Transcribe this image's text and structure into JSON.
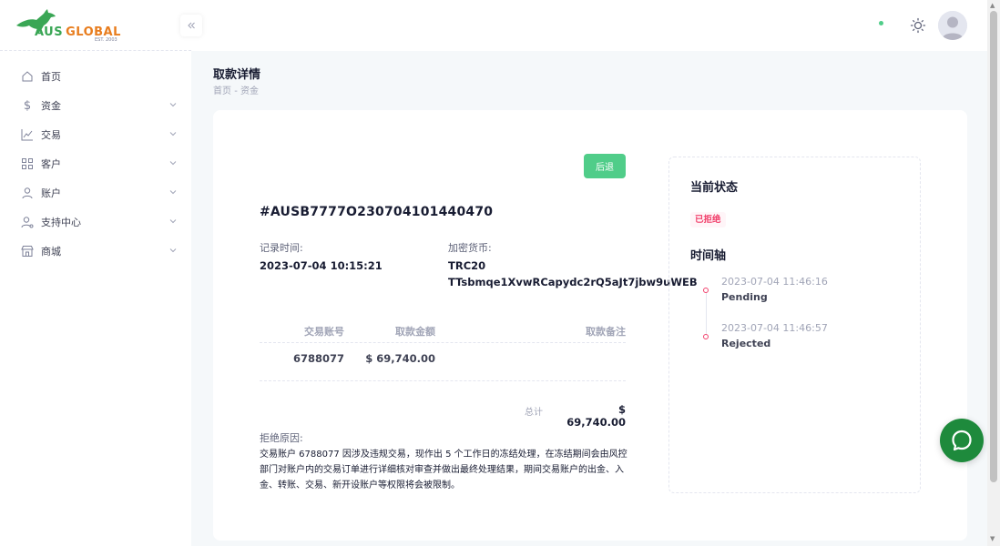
{
  "brand": {
    "name_part1": "AUS",
    "name_part2": "GLOBAL",
    "est": "EST. 2003"
  },
  "sidebar": {
    "items": [
      {
        "label": "首页",
        "icon": "home-icon",
        "has_chevron": false
      },
      {
        "label": "资金",
        "icon": "dollar-icon",
        "has_chevron": true
      },
      {
        "label": "交易",
        "icon": "chart-line-icon",
        "has_chevron": true
      },
      {
        "label": "客户",
        "icon": "grid-icon",
        "has_chevron": true
      },
      {
        "label": "账户",
        "icon": "user-icon",
        "has_chevron": true
      },
      {
        "label": "支持中心",
        "icon": "support-icon",
        "has_chevron": true
      },
      {
        "label": "商城",
        "icon": "store-icon",
        "has_chevron": true
      }
    ]
  },
  "page": {
    "title": "取款详情",
    "breadcrumb": [
      "首页",
      "资金"
    ]
  },
  "detail": {
    "back_label": "后退",
    "order_id": "#AUSB7777O230704101440470",
    "record_time_label": "记录时间:",
    "record_time": "2023-07-04 10:15:21",
    "crypto_label": "加密货币:",
    "crypto_network": "TRC20",
    "crypto_address": "TTsbmqe1XvwRCapydc2rQ5aJt7jbw9uWEB",
    "table": {
      "headers": [
        "交易账号",
        "取款金额",
        "取款备注"
      ],
      "rows": [
        {
          "account": "6788077",
          "amount": "$ 69,740.00",
          "note": ""
        }
      ]
    },
    "total_label": "总计",
    "total_value": "$ 69,740.00",
    "reason_label": "拒绝原因:",
    "reason_text": "交易账户 6788077 因涉及违规交易，现作出 5 个工作日的冻结处理，在冻结期间会由风控部门对账户内的交易订单进行详细核对审查并做出最终处理结果，期间交易账户的出金、入金、转账、交易、新开设账户等权限将会被限制。"
  },
  "status_panel": {
    "title": "当前状态",
    "badge": "已拒绝",
    "badge_color": "#f1416c",
    "timeline_title": "时间轴",
    "timeline": [
      {
        "time": "2023-07-04 11:46:16",
        "status": "Pending"
      },
      {
        "time": "2023-07-04 11:46:57",
        "status": "Rejected"
      }
    ]
  },
  "colors": {
    "accent_green": "#50cd89",
    "danger": "#f1416c",
    "chat": "#1e8a3c"
  }
}
